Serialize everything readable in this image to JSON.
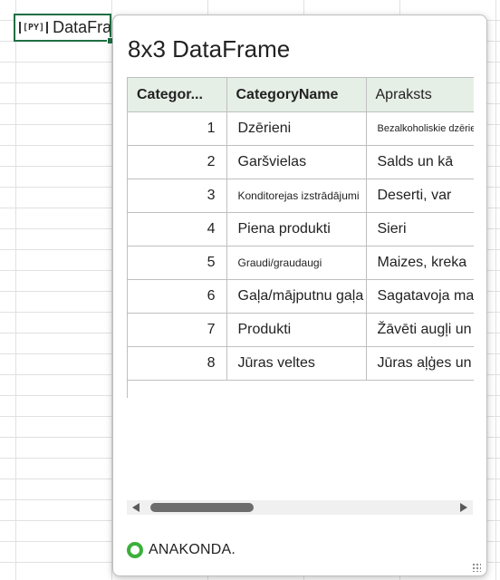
{
  "sheet": {
    "active_cell": {
      "badge": "[PY]",
      "text": "DataFrar"
    }
  },
  "card": {
    "title": "8x3 DataFrame",
    "table": {
      "headers": [
        "Categor...",
        "CategoryName",
        "Apraksts"
      ],
      "rows": [
        [
          "1",
          "Dzērieni",
          "Bezalkoholiskie dzērieni, c"
        ],
        [
          "2",
          "Garšvielas",
          "Salds un kā"
        ],
        [
          "3",
          "Konditorejas izstrādājumi",
          "Deserti, var"
        ],
        [
          "4",
          "Piena produkti",
          "Sieri"
        ],
        [
          "5",
          "Graudi/graudaugi",
          "Maizes, kreka"
        ],
        [
          "6",
          "Gaļa/mājputnu gaļa",
          "Sagatavoja mani;"
        ],
        [
          "7",
          "Produkti",
          "Žāvēti augļi un"
        ],
        [
          "8",
          "Jūras veltes",
          "Jūras aļģes un"
        ]
      ]
    },
    "footer": {
      "brand": "ANAKONDA."
    }
  }
}
